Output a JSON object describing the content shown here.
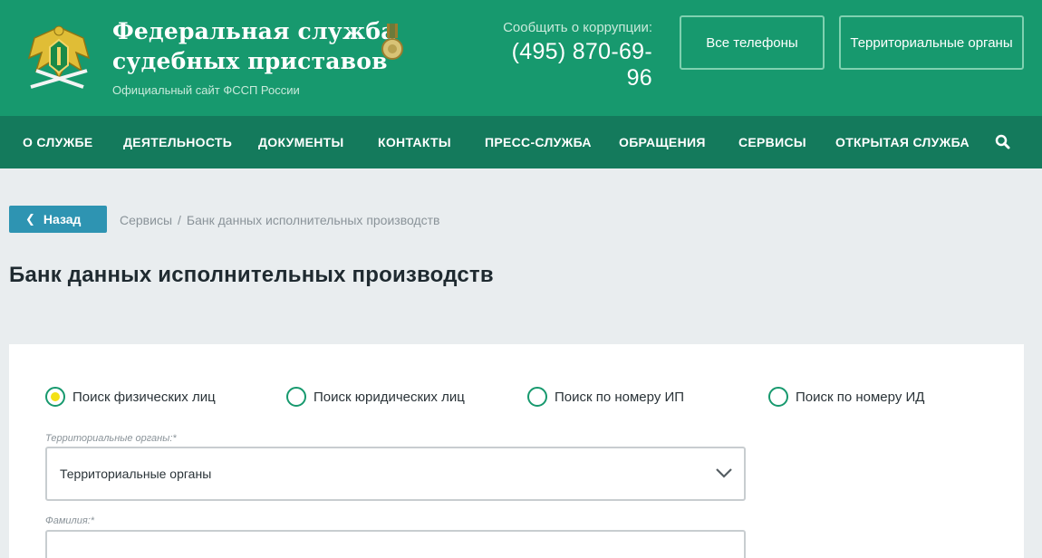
{
  "header": {
    "title_line1": "Федеральная служба",
    "title_line2": "судебных приставов",
    "subtitle": "Официальный сайт ФССП России",
    "corruption_label": "Сообщить о коррупции:",
    "corruption_phone": "(495) 870-69-96",
    "phones_button": "Все телефоны",
    "territorial_button": "Территориальные органы"
  },
  "nav": {
    "items": [
      "О СЛУЖБЕ",
      "ДЕЯТЕЛЬНОСТЬ",
      "ДОКУМЕНТЫ",
      "КОНТАКТЫ",
      "ПРЕСС-СЛУЖБА",
      "ОБРАЩЕНИЯ",
      "СЕРВИСЫ",
      "ОТКРЫТАЯ СЛУЖБА"
    ],
    "search_icon": "search-icon"
  },
  "back_button": "Назад",
  "breadcrumb": {
    "items": [
      "Сервисы",
      "Банк данных исполнительных производств"
    ],
    "separator": "/"
  },
  "page_title": "Банк данных исполнительных производств",
  "search_form": {
    "modes": [
      {
        "label": "Поиск физических лиц",
        "selected": true
      },
      {
        "label": "Поиск юридических лиц",
        "selected": false
      },
      {
        "label": "Поиск по номеру ИП",
        "selected": false
      },
      {
        "label": "Поиск по номеру ИД",
        "selected": false
      }
    ],
    "territorial_label": "Территориальные органы:*",
    "territorial_value": "Территориальные органы",
    "lastname_label": "Фамилия:*",
    "lastname_value": ""
  },
  "colors": {
    "header_green": "#17996e",
    "nav_green": "#147a5c",
    "back_button_blue": "#2e94b2",
    "radio_selected_dot": "#f4e116"
  }
}
